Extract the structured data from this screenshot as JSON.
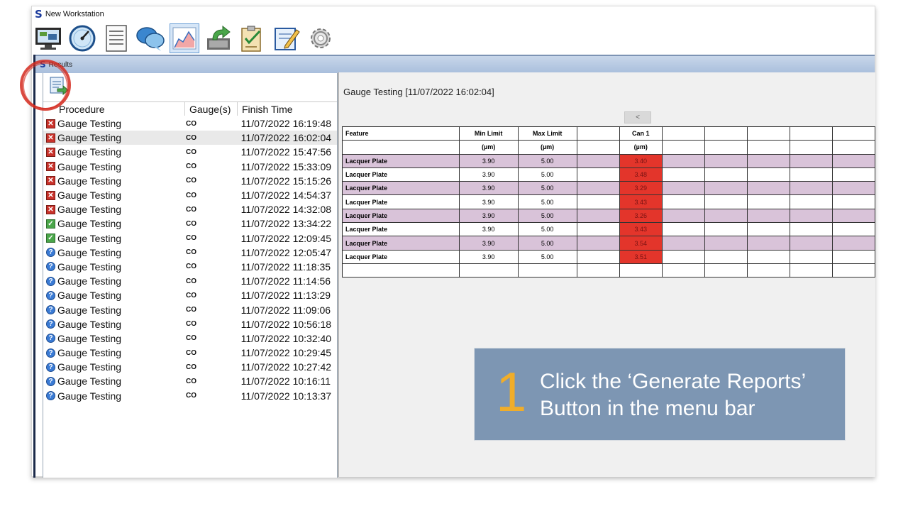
{
  "window": {
    "title": "New Workstation"
  },
  "toolbar": {
    "icons": [
      "workstation-icon",
      "gauge-dial-icon",
      "data-sheet-icon",
      "chat-icon",
      "chart-icon",
      "export-icon",
      "checklist-icon",
      "edit-form-icon",
      "gear-icon"
    ]
  },
  "results": {
    "title": "Results",
    "columns": {
      "procedure": "Procedure",
      "gauges": "Gauge(s)",
      "finish_time": "Finish Time"
    },
    "rows": [
      {
        "status": "fail",
        "procedure": "Gauge Testing",
        "gauges": "CO",
        "finish": "11/07/2022 16:19:48"
      },
      {
        "status": "fail",
        "procedure": "Gauge Testing",
        "gauges": "CO",
        "finish": "11/07/2022 16:02:04"
      },
      {
        "status": "fail",
        "procedure": "Gauge Testing",
        "gauges": "CO",
        "finish": "11/07/2022 15:47:56"
      },
      {
        "status": "fail",
        "procedure": "Gauge Testing",
        "gauges": "CO",
        "finish": "11/07/2022 15:33:09"
      },
      {
        "status": "fail",
        "procedure": "Gauge Testing",
        "gauges": "CO",
        "finish": "11/07/2022 15:15:26"
      },
      {
        "status": "fail",
        "procedure": "Gauge Testing",
        "gauges": "CO",
        "finish": "11/07/2022 14:54:37"
      },
      {
        "status": "fail",
        "procedure": "Gauge Testing",
        "gauges": "CO",
        "finish": "11/07/2022 14:32:08"
      },
      {
        "status": "pass",
        "procedure": "Gauge Testing",
        "gauges": "CO",
        "finish": "11/07/2022 13:34:22"
      },
      {
        "status": "pass",
        "procedure": "Gauge Testing",
        "gauges": "CO",
        "finish": "11/07/2022 12:09:45"
      },
      {
        "status": "unknown",
        "procedure": "Gauge Testing",
        "gauges": "CO",
        "finish": "11/07/2022 12:05:47"
      },
      {
        "status": "unknown",
        "procedure": "Gauge Testing",
        "gauges": "CO",
        "finish": "11/07/2022 11:18:35"
      },
      {
        "status": "unknown",
        "procedure": "Gauge Testing",
        "gauges": "CO",
        "finish": "11/07/2022 11:14:56"
      },
      {
        "status": "unknown",
        "procedure": "Gauge Testing",
        "gauges": "CO",
        "finish": "11/07/2022 11:13:29"
      },
      {
        "status": "unknown",
        "procedure": "Gauge Testing",
        "gauges": "CO",
        "finish": "11/07/2022 11:09:06"
      },
      {
        "status": "unknown",
        "procedure": "Gauge Testing",
        "gauges": "CO",
        "finish": "11/07/2022 10:56:18"
      },
      {
        "status": "unknown",
        "procedure": "Gauge Testing",
        "gauges": "CO",
        "finish": "11/07/2022 10:32:40"
      },
      {
        "status": "unknown",
        "procedure": "Gauge Testing",
        "gauges": "CO",
        "finish": "11/07/2022 10:29:45"
      },
      {
        "status": "unknown",
        "procedure": "Gauge Testing",
        "gauges": "CO",
        "finish": "11/07/2022 10:27:42"
      },
      {
        "status": "unknown",
        "procedure": "Gauge Testing",
        "gauges": "CO",
        "finish": "11/07/2022 10:16:11"
      },
      {
        "status": "unknown",
        "procedure": "Gauge Testing",
        "gauges": "CO",
        "finish": "11/07/2022 10:13:37"
      }
    ],
    "selected_index": 1
  },
  "detail": {
    "title": "Gauge Testing [11/07/2022 16:02:04]",
    "scroll_left_label": "<",
    "headers": {
      "feature": "Feature",
      "min": "Min Limit",
      "max": "Max Limit",
      "can": "Can 1"
    },
    "units": {
      "min": "(µm)",
      "max": "(µm)",
      "can": "(µm)"
    },
    "rows": [
      {
        "feature": "Lacquer Plate",
        "min": "3.90",
        "max": "5.00",
        "can": "3.40"
      },
      {
        "feature": "Lacquer Plate",
        "min": "3.90",
        "max": "5.00",
        "can": "3.48"
      },
      {
        "feature": "Lacquer Plate",
        "min": "3.90",
        "max": "5.00",
        "can": "3.29"
      },
      {
        "feature": "Lacquer Plate",
        "min": "3.90",
        "max": "5.00",
        "can": "3.43"
      },
      {
        "feature": "Lacquer Plate",
        "min": "3.90",
        "max": "5.00",
        "can": "3.26"
      },
      {
        "feature": "Lacquer Plate",
        "min": "3.90",
        "max": "5.00",
        "can": "3.43"
      },
      {
        "feature": "Lacquer Plate",
        "min": "3.90",
        "max": "5.00",
        "can": "3.54"
      },
      {
        "feature": "Lacquer Plate",
        "min": "3.90",
        "max": "5.00",
        "can": "3.51"
      }
    ]
  },
  "callout": {
    "number": "1",
    "line1": "Click the ‘Generate Reports’",
    "line2": "Button in the menu bar"
  },
  "colors": {
    "accent_blue": "#1a3a9c",
    "fail_red": "#e3352b",
    "alt_row": "#d9c3d9",
    "callout_bg": "#7d96b3",
    "callout_num": "#f0ad2a",
    "highlight_circle": "#d42a1e"
  }
}
